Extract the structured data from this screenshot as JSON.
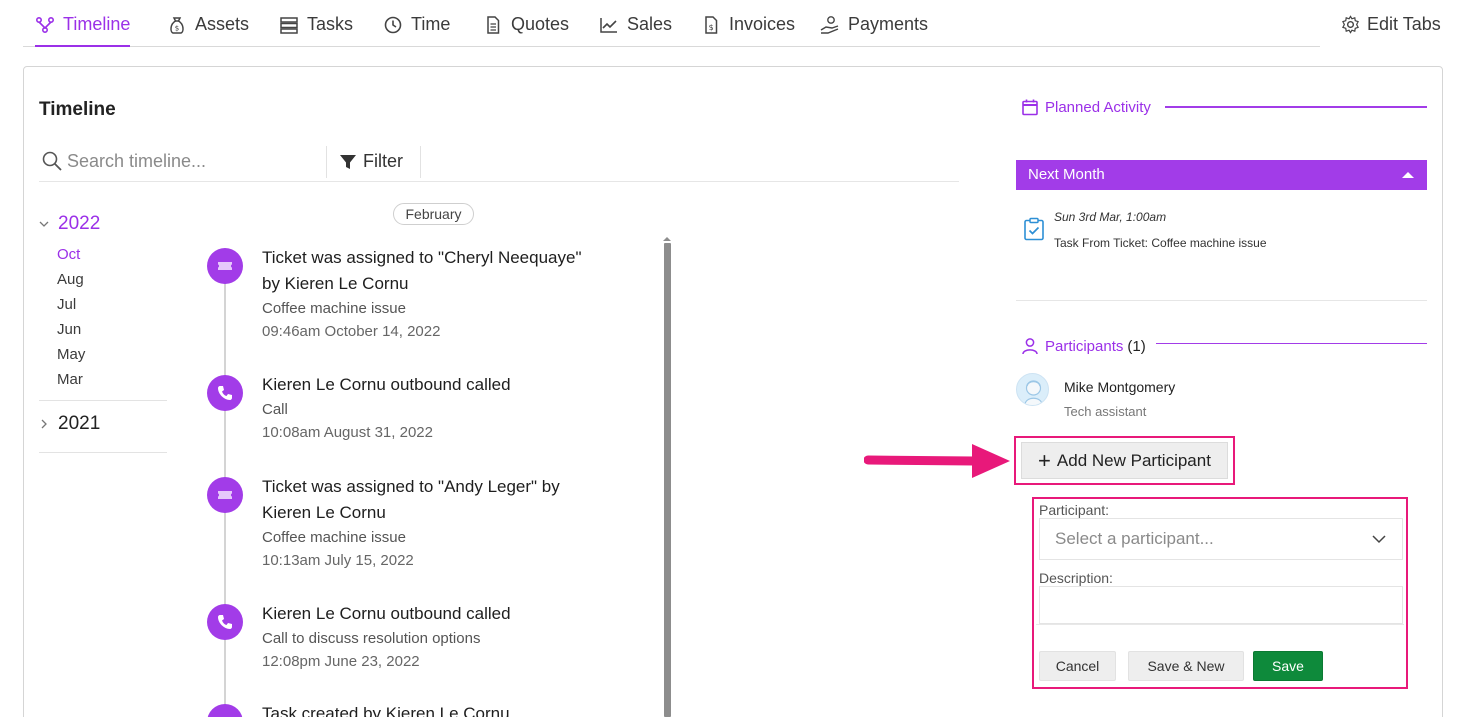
{
  "tabs": [
    {
      "label": "Timeline",
      "icon": "timeline-icon",
      "active": true
    },
    {
      "label": "Assets",
      "icon": "money-bag-icon"
    },
    {
      "label": "Tasks",
      "icon": "tasks-list-icon"
    },
    {
      "label": "Time",
      "icon": "clock-icon"
    },
    {
      "label": "Quotes",
      "icon": "document-icon"
    },
    {
      "label": "Sales",
      "icon": "chart-line-icon"
    },
    {
      "label": "Invoices",
      "icon": "invoice-icon"
    },
    {
      "label": "Payments",
      "icon": "hand-coin-icon"
    }
  ],
  "edit_tabs_label": "Edit Tabs",
  "timeline": {
    "title": "Timeline",
    "search_placeholder": "Search timeline...",
    "filter_label": "Filter",
    "month_pill": "February",
    "years": [
      {
        "year": "2022",
        "expanded": true,
        "months": [
          "Oct",
          "Aug",
          "Jul",
          "Jun",
          "May",
          "Mar"
        ],
        "selected_month": "Oct"
      },
      {
        "year": "2021",
        "expanded": false
      }
    ],
    "entries": [
      {
        "type": "ticket",
        "title": "Ticket was assigned to \"Cheryl Neequaye\" by Kieren Le Cornu",
        "subtitle": "Coffee machine issue",
        "date": "09:46am October 14, 2022"
      },
      {
        "type": "call",
        "title": "Kieren Le Cornu outbound called",
        "subtitle": "Call",
        "date": "10:08am August 31, 2022"
      },
      {
        "type": "ticket",
        "title": "Ticket was assigned to \"Andy Leger\" by Kieren Le Cornu",
        "subtitle": "Coffee machine issue",
        "date": "10:13am July 15, 2022"
      },
      {
        "type": "call",
        "title": "Kieren Le Cornu outbound called",
        "subtitle": "Call to discuss resolution options",
        "date": "12:08pm June 23, 2022"
      },
      {
        "type": "task",
        "title": "Task created by Kieren Le Cornu",
        "subtitle": "",
        "date": ""
      }
    ]
  },
  "planned_activity": {
    "heading": "Planned Activity",
    "group_label": "Next Month",
    "items": [
      {
        "date": "Sun 3rd Mar, 1:00am",
        "description": "Task From Ticket: Coffee machine issue"
      }
    ]
  },
  "participants": {
    "heading": "Participants",
    "count": "(1)",
    "list": [
      {
        "name": "Mike Montgomery",
        "role": "Tech assistant"
      }
    ],
    "add_button_label": "Add New Participant"
  },
  "participant_form": {
    "participant_label": "Participant:",
    "participant_placeholder": "Select a participant...",
    "description_label": "Description:",
    "cancel_label": "Cancel",
    "save_new_label": "Save & New",
    "save_label": "Save"
  },
  "colors": {
    "accent": "#9b30e8",
    "highlight": "#e8197a",
    "save": "#0e8a3b"
  }
}
